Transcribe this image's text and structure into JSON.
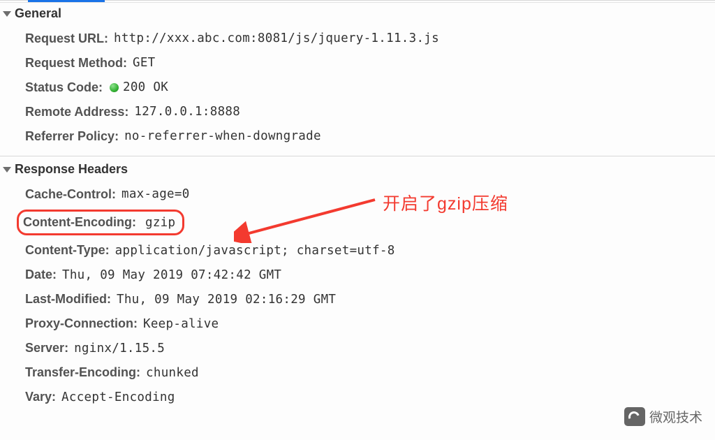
{
  "sections": {
    "general": {
      "title": "General",
      "request_url_key": "Request URL",
      "request_url_val": "http://xxx.abc.com:8081/js/jquery-1.11.3.js",
      "request_method_key": "Request Method",
      "request_method_val": "GET",
      "status_code_key": "Status Code",
      "status_code_val": "200 OK",
      "remote_address_key": "Remote Address",
      "remote_address_val": "127.0.0.1:8888",
      "referrer_policy_key": "Referrer Policy",
      "referrer_policy_val": "no-referrer-when-downgrade"
    },
    "response_headers": {
      "title": "Response Headers",
      "cache_control_key": "Cache-Control",
      "cache_control_val": "max-age=0",
      "content_encoding_key": "Content-Encoding",
      "content_encoding_val": "gzip",
      "content_type_key": "Content-Type",
      "content_type_val": "application/javascript; charset=utf-8",
      "date_key": "Date",
      "date_val": "Thu, 09 May 2019 07:42:42 GMT",
      "last_modified_key": "Last-Modified",
      "last_modified_val": "Thu, 09 May 2019 02:16:29 GMT",
      "proxy_connection_key": "Proxy-Connection",
      "proxy_connection_val": "Keep-alive",
      "server_key": "Server",
      "server_val": "nginx/1.15.5",
      "transfer_encoding_key": "Transfer-Encoding",
      "transfer_encoding_val": "chunked",
      "vary_key": "Vary",
      "vary_val": "Accept-Encoding"
    }
  },
  "annotation": {
    "text": "开启了gzip压缩",
    "color": "#f33a2f"
  },
  "watermark": {
    "text": "微观技术"
  }
}
